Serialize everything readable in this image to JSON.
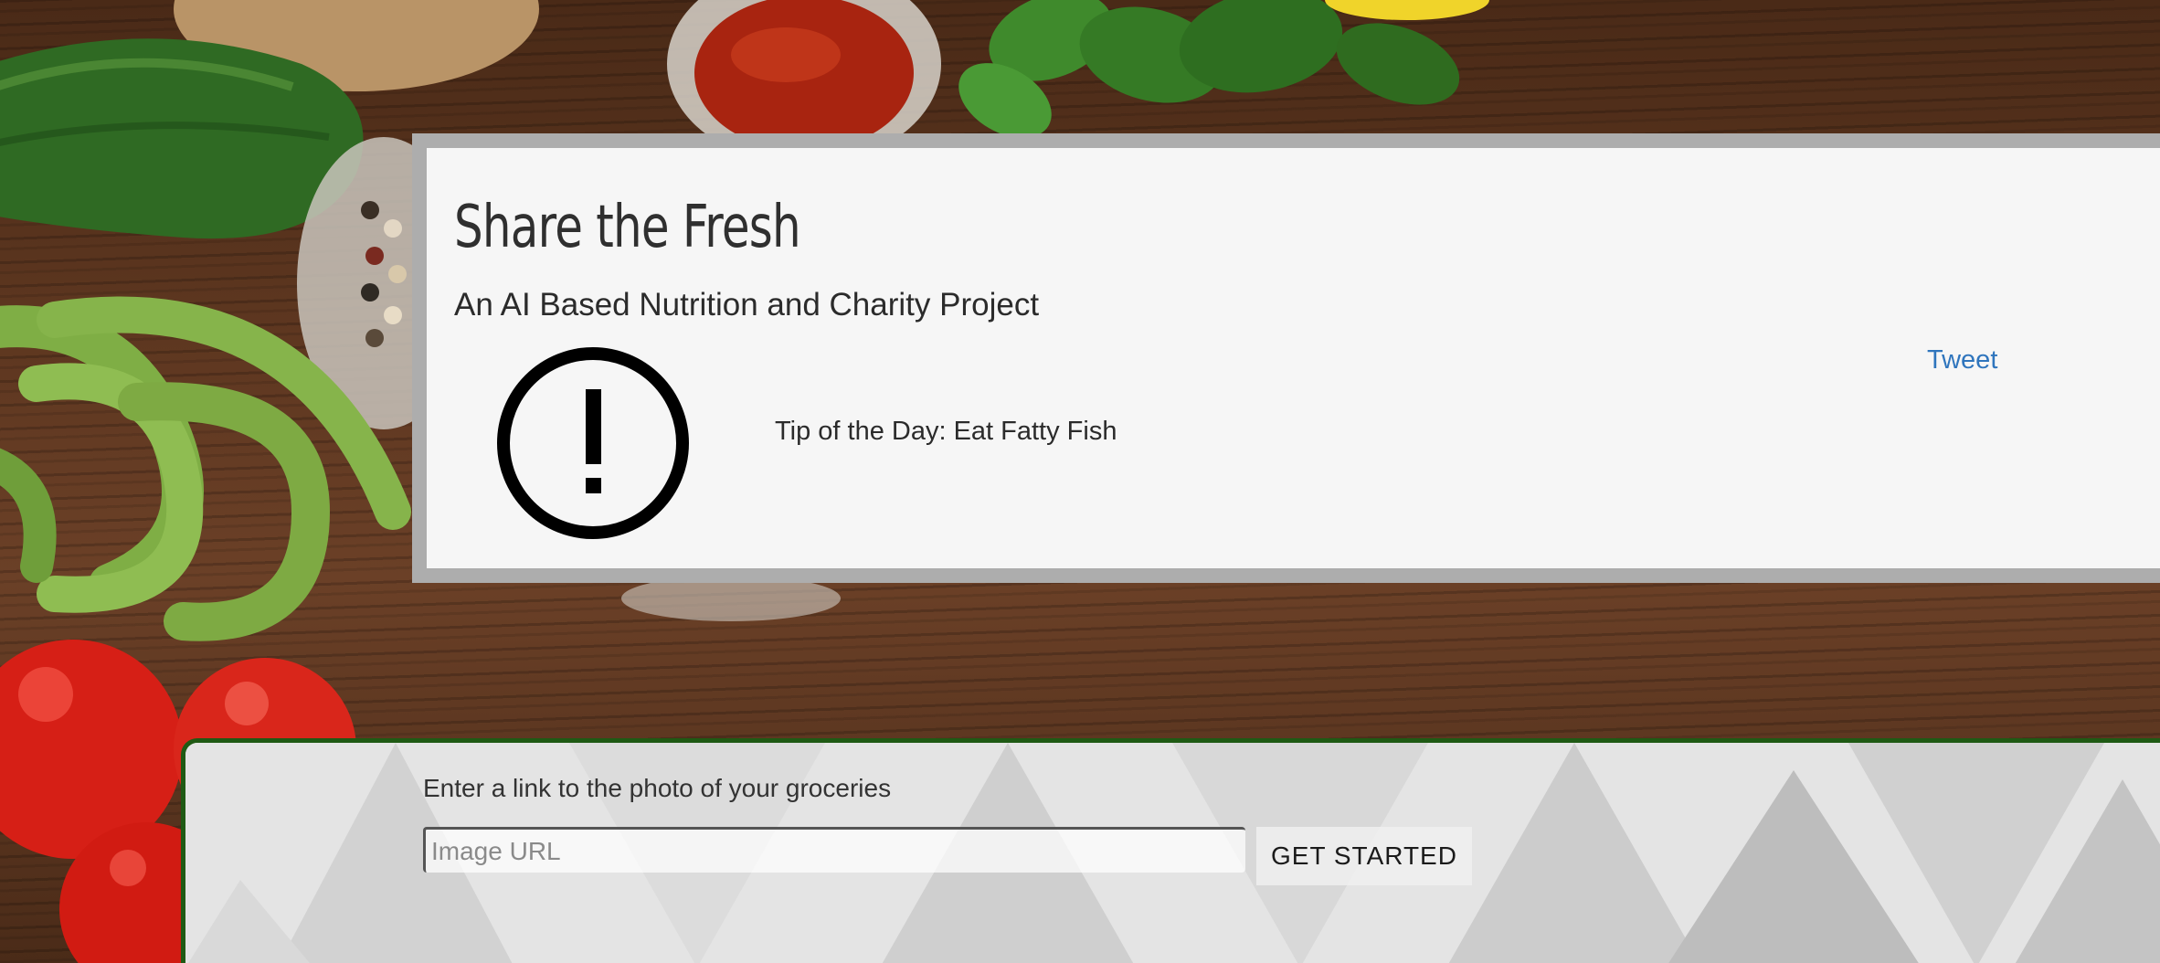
{
  "hero": {
    "title": "Share the Fresh",
    "subtitle": "An AI Based Nutrition and Charity Project",
    "tweet_label": "Tweet",
    "tip": "Tip of the Day: Eat Fatty Fish",
    "icon": "exclamation-circle-icon"
  },
  "groceries_form": {
    "label": "Enter a link to the photo of your groceries",
    "input_placeholder": "Image URL",
    "input_value": "",
    "submit_label": "GET STARTED"
  },
  "colors": {
    "panel_border": "#1f5a14",
    "link": "#2f75bd",
    "card_frame": "#adadad",
    "card_bg": "#f6f6f6"
  }
}
